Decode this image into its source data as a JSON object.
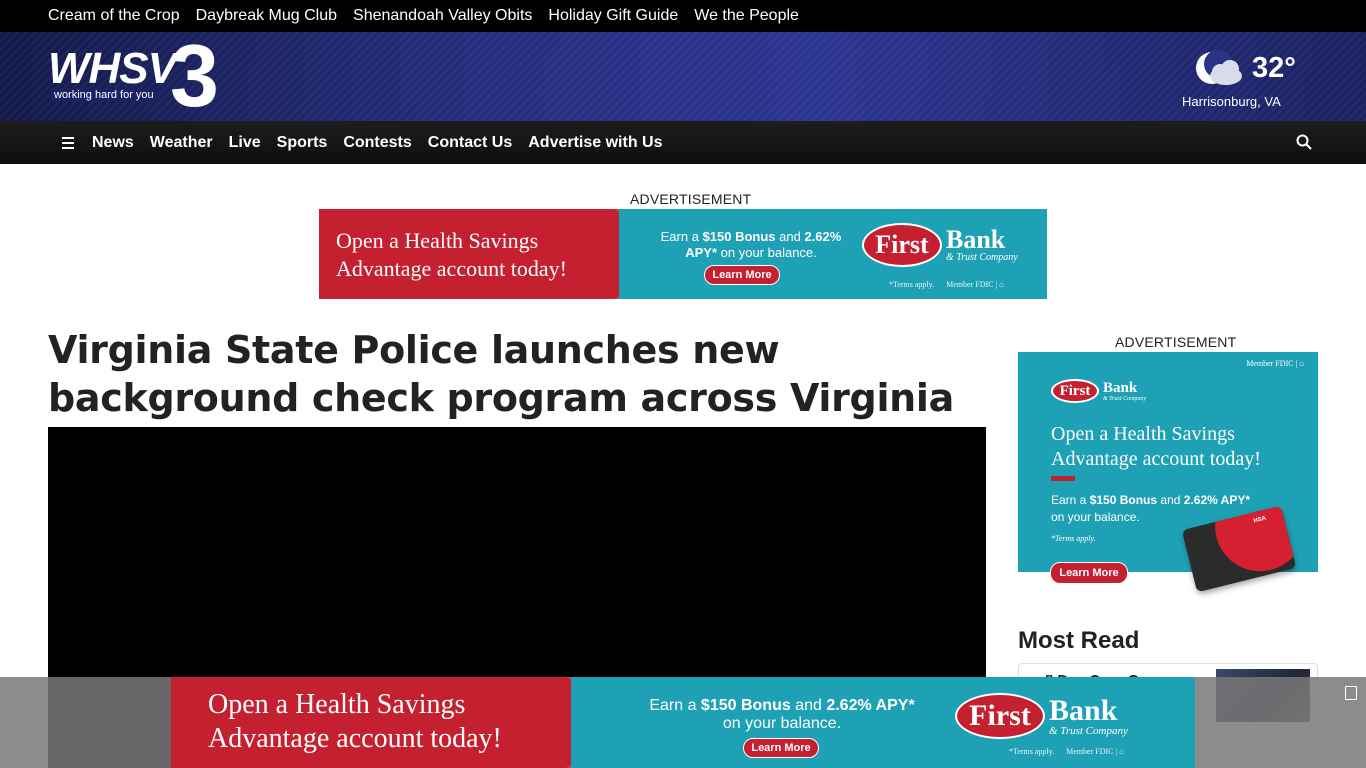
{
  "topbar": {
    "links": [
      "Cream of the Crop",
      "Daybreak Mug Club",
      "Shenandoah Valley Obits",
      "Holiday Gift Guide",
      "We the People"
    ]
  },
  "logo": {
    "call": "WHSV",
    "number": "3",
    "tagline": "working hard for you"
  },
  "weather": {
    "temperature": "32°",
    "location": "Harrisonburg, VA",
    "icon": "partly-cloudy-night-icon"
  },
  "nav": {
    "items": [
      "News",
      "Weather",
      "Live",
      "Sports",
      "Contests",
      "Contact Us",
      "Advertise with Us"
    ]
  },
  "ad_label": "ADVERTISEMENT",
  "banner_ad": {
    "headline_1": "Open a Health Savings",
    "headline_2": "Advantage account today!",
    "bonus_prefix": "Earn a ",
    "bonus_amount": "$150 Bonus",
    "bonus_mid": " and ",
    "apy": "2.62%",
    "apy_label": "APY*",
    "bonus_suffix": " on your balance.",
    "cta": "Learn More",
    "brand_first": "First",
    "brand_bank": "Bank",
    "brand_sub": "& Trust Company",
    "terms": "*Terms apply.",
    "member": "Member FDIC |"
  },
  "article": {
    "headline": "Virginia State Police launches new background check program across Virginia"
  },
  "side_ad": {
    "member": "Member FDIC |",
    "brand_first": "First",
    "brand_bank": "Bank",
    "brand_sub": "& Trust Company",
    "headline_1": "Open a Health Savings",
    "headline_2": "Advantage account today!",
    "text_1_prefix": "Earn a ",
    "text_1_bold": "$150 Bonus",
    "text_1_mid": " and ",
    "text_1_bold2": "2.62% APY*",
    "text_2": "on your balance.",
    "terms": "*Terms apply.",
    "cta": "Learn More",
    "card_label": "HSA"
  },
  "most_read": {
    "title": "Most Read",
    "first_item": "Day One: Governor"
  },
  "sticky_ad": {
    "headline_1": "Open a Health Savings",
    "headline_2": "Advantage account today!",
    "bonus_prefix": "Earn a ",
    "bonus_amount": "$150 Bonus",
    "bonus_mid": " and ",
    "apy": "2.62% APY*",
    "bonus_line2": "on your balance.",
    "cta": "Learn More",
    "brand_first": "First",
    "brand_bank": "Bank",
    "brand_sub": "& Trust Company",
    "terms": "*Terms apply.",
    "member": "Member FDIC |"
  },
  "colors": {
    "brand_navy": "#252e7e",
    "ad_red": "#c4202f",
    "ad_teal": "#1fa1b5"
  }
}
